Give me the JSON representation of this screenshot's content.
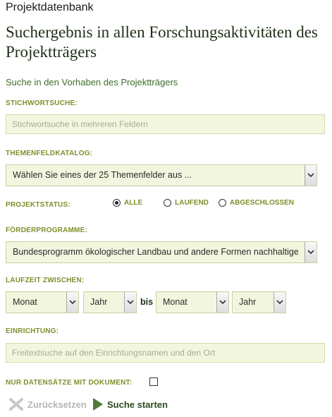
{
  "header": {
    "site_title": "Projektdatenbank",
    "page_title": "Suchergebnis in allen Forschungsaktivitäten des Projektträgers",
    "subtitle": "Suche in den Vorhaben des Projektträgers"
  },
  "form": {
    "keyword": {
      "label": "STICHWORTSUCHE:",
      "placeholder": "Stichwortsuche in mehreren Feldern",
      "value": ""
    },
    "topic_catalog": {
      "label": "THEMENFELDKATALOG:",
      "selected": "Wählen Sie eines der 25 Themenfelder aus ..."
    },
    "project_status": {
      "label": "PROJEKTSTATUS:",
      "options": [
        {
          "label": "ALLE",
          "checked": true
        },
        {
          "label": "LAUFEND",
          "checked": false
        },
        {
          "label": "ABGESCHLOSSEN",
          "checked": false
        }
      ]
    },
    "funding_programs": {
      "label": "FÖRDERPROGRAMME:",
      "selected": "Bundesprogramm ökologischer Landbau und andere Formen nachhaltiger Landwirtschaft"
    },
    "duration": {
      "label": "LAUFZEIT ZWISCHEN:",
      "from_month": "Monat",
      "from_year": "Jahr",
      "between": "bis",
      "to_month": "Monat",
      "to_year": "Jahr"
    },
    "institution": {
      "label": "EINRICHTUNG:",
      "placeholder": "Freitextsuche auf den Einrichtungsnamen und den Ort",
      "value": ""
    },
    "only_with_document": {
      "label": "NUR DATENSÄTZE MIT DOKUMENT:",
      "checked": false
    }
  },
  "actions": {
    "reset_label": "Zurücksetzen",
    "search_label": "Suche starten"
  },
  "colors": {
    "label_green": "#7d8f2b",
    "field_bg": "#f3f6df",
    "title_dark": "#1e2f17",
    "subtitle_green": "#3f6f2c"
  }
}
